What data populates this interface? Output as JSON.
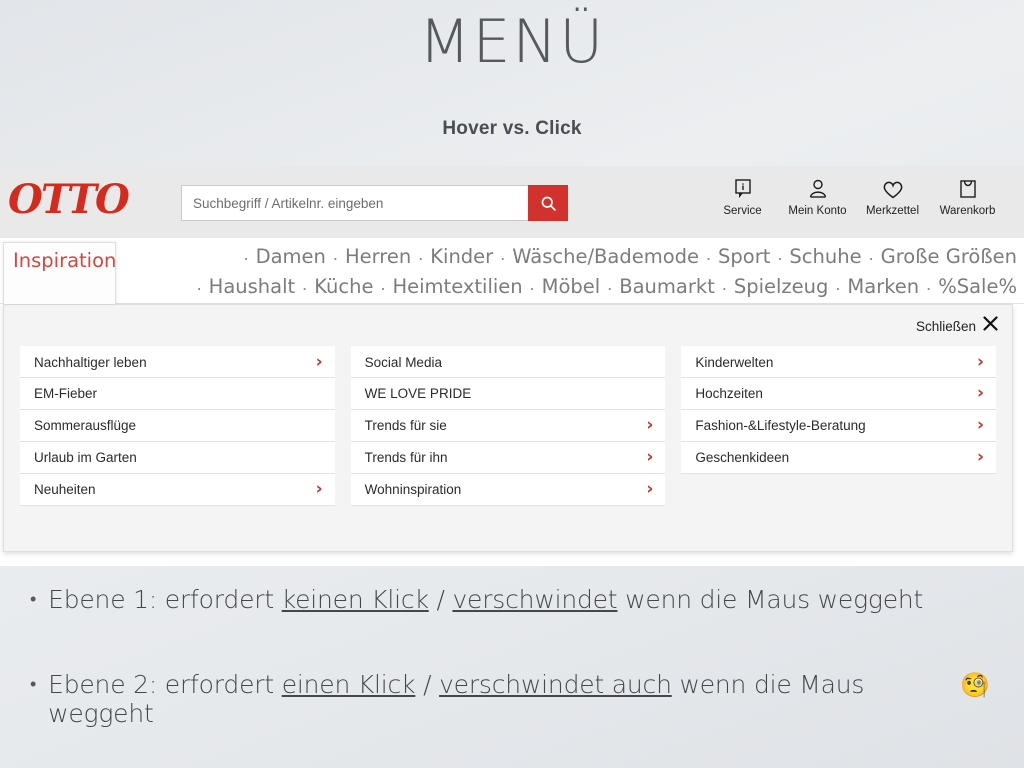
{
  "slide": {
    "title": "MENÜ",
    "subtitle": "Hover vs. Click"
  },
  "otto": {
    "logo": "OTTO",
    "search": {
      "placeholder": "Suchbegriff / Artikelnr. eingeben",
      "value": "",
      "button_icon": "search-icon",
      "button_color": "#d2322d"
    },
    "header_icons": [
      {
        "label": "Service",
        "icon": "info-speech-bubble-icon"
      },
      {
        "label": "Mein Konto",
        "icon": "user-account-icon"
      },
      {
        "label": "Merkzettel",
        "icon": "heart-icon"
      },
      {
        "label": "Warenkorb",
        "icon": "shopping-bag-icon"
      }
    ],
    "active_tab": {
      "label": "Inspiration",
      "color": "#d2483f"
    },
    "nav_row_1": [
      "Damen",
      "Herren",
      "Kinder",
      "Wäsche/Bademode",
      "Sport",
      "Schuhe",
      "Große Größen"
    ],
    "nav_row_2": [
      "Haushalt",
      "Küche",
      "Heimtextilien",
      "Möbel",
      "Baumarkt",
      "Spielzeug",
      "Marken",
      "%Sale%"
    ],
    "nav_separator": ".",
    "mega_menu": {
      "close_label": "Schließen",
      "close_icon": "close-x-icon",
      "chevron_icon": "chevron-right-icon",
      "chevron_color": "#c0392b",
      "columns": [
        {
          "items": [
            {
              "label": "Nachhaltiger leben",
              "has_chevron": true
            },
            {
              "label": "EM-Fieber",
              "has_chevron": false
            },
            {
              "label": "Sommerausflüge",
              "has_chevron": false
            },
            {
              "label": "Urlaub im Garten",
              "has_chevron": false
            },
            {
              "label": "Neuheiten",
              "has_chevron": true
            }
          ]
        },
        {
          "items": [
            {
              "label": "Social Media",
              "has_chevron": false
            },
            {
              "label": "WE LOVE PRIDE",
              "has_chevron": false
            },
            {
              "label": "Trends für sie",
              "has_chevron": true
            },
            {
              "label": "Trends für ihn",
              "has_chevron": true
            },
            {
              "label": "Wohninspiration",
              "has_chevron": true
            }
          ]
        },
        {
          "items": [
            {
              "label": "Kinderwelten",
              "has_chevron": true
            },
            {
              "label": "Hochzeiten",
              "has_chevron": true
            },
            {
              "label": "Fashion-&Lifestyle-Beratung",
              "has_chevron": true
            },
            {
              "label": "Geschenkideen",
              "has_chevron": true
            }
          ]
        }
      ]
    }
  },
  "bullets": [
    {
      "dot": "•",
      "part1": "Ebene 1: erfordert ",
      "u1": "keinen Klick",
      "part2": " / ",
      "u2": "verschwindet",
      "part3": " wenn die Maus weggeht",
      "emoji": ""
    },
    {
      "dot": "•",
      "part1": "Ebene 2: erfordert ",
      "u1": "einen Klick",
      "part2": " / ",
      "u2": "verschwindet auch",
      "part3": " wenn die Maus weggeht",
      "emoji": "🧐"
    }
  ]
}
